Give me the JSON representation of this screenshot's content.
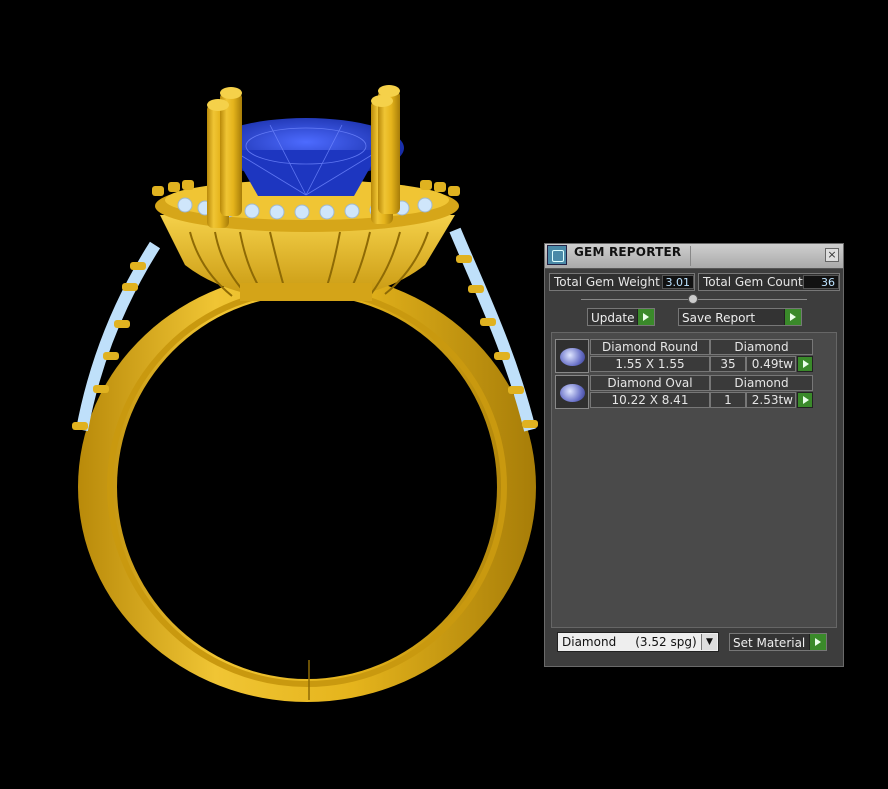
{
  "panel": {
    "title": "GEM REPORTER",
    "close_glyph": "×",
    "total_weight_label": "Total Gem Weight",
    "total_weight_value": "3.01",
    "total_count_label": "Total Gem Count",
    "total_count_value": "36",
    "update_label": "Update",
    "save_report_label": "Save Report",
    "gems": [
      {
        "name": "Diamond Round",
        "material": "Diamond",
        "size": "1.55 X 1.55",
        "count": "35",
        "weight": "0.49tw"
      },
      {
        "name": "Diamond Oval",
        "material": "Diamond",
        "size": "10.22 X 8.41",
        "count": "1",
        "weight": "2.53tw"
      }
    ],
    "material_select": "Diamond     (3.52 spg)",
    "set_material_label": "Set Material"
  },
  "colors": {
    "metal": "#E5B41C",
    "center_stone": "#1F3FC8",
    "side_stones": "#BFDDF7",
    "accent_green": "#3A8A2A"
  }
}
